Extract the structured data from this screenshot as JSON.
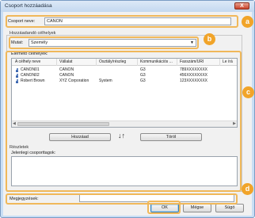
{
  "window": {
    "title": "Csoport hozzáadása",
    "close_glyph": "X"
  },
  "group_name": {
    "label": "Csoport neve:",
    "value": "CANON"
  },
  "selectable_targets": {
    "section_label": "Hozzáadandó célhelyek",
    "type_label": "Mutat:",
    "type_value": "Személy",
    "available_label": "Elérhető célhelyek:",
    "columns": [
      "A célhely neve",
      "Vállalat",
      "Osztály/részleg",
      "Kommunikációs ...",
      "Faxszám/URI",
      "Le írá"
    ],
    "rows": [
      {
        "name": "CANON01",
        "company": "CANON",
        "department": "",
        "comm": "G3",
        "fax": "789XXXXXXXX"
      },
      {
        "name": "CANON02",
        "company": "CANON",
        "department": "",
        "comm": "G3",
        "fax": "456XXXXXXXX"
      },
      {
        "name": "Robert Brown",
        "company": "XYZ Corporation",
        "department": "System",
        "comm": "G3",
        "fax": "123XXXXXXXX"
      }
    ],
    "scroll_left": "◀",
    "scroll_right": "▶"
  },
  "actions": {
    "add_label": "Hozzáad",
    "delete_label": "Töröl",
    "move_glyph": "↓↑"
  },
  "members": {
    "section_label": "Részletek",
    "current_members_label": "Jelenlegi csoporttagok:"
  },
  "notes": {
    "label": "Megjegyzések:",
    "value": ""
  },
  "footer": {
    "ok_label": "OK",
    "cancel_label": "Mégse",
    "help_label": "Súgó"
  },
  "callouts": [
    "a",
    "b",
    "c",
    "d"
  ],
  "colors": {
    "callout": "#f1a429",
    "window_frame": "#c9dff5"
  }
}
